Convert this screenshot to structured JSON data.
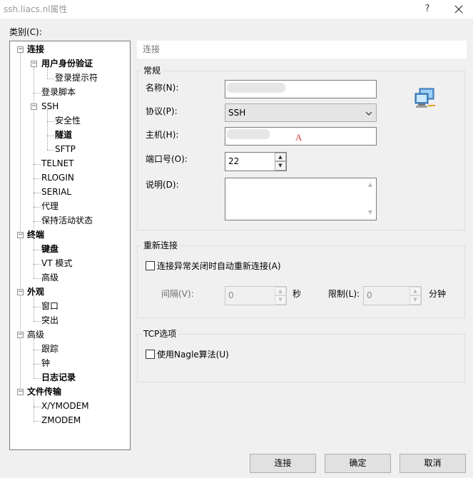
{
  "window": {
    "title": "ssh.liacs.nl属性",
    "help": "?",
    "close_icon": "close-icon"
  },
  "category_label": "类别(C):",
  "tree": {
    "items": [
      {
        "label": "连接",
        "bold": true,
        "expander": "−"
      },
      {
        "label": "用户身份验证",
        "bold": true,
        "expander": "−"
      },
      {
        "label": "登录提示符",
        "bold": false
      },
      {
        "label": "登录脚本",
        "bold": false
      },
      {
        "label": "SSH",
        "bold": false,
        "expander": "−"
      },
      {
        "label": "安全性",
        "bold": false
      },
      {
        "label": "隧道",
        "bold": true
      },
      {
        "label": "SFTP",
        "bold": false
      },
      {
        "label": "TELNET",
        "bold": false
      },
      {
        "label": "RLOGIN",
        "bold": false
      },
      {
        "label": "SERIAL",
        "bold": false
      },
      {
        "label": "代理",
        "bold": false
      },
      {
        "label": "保持活动状态",
        "bold": false
      },
      {
        "label": "终端",
        "bold": true,
        "expander": "−"
      },
      {
        "label": "键盘",
        "bold": true
      },
      {
        "label": "VT 模式",
        "bold": false
      },
      {
        "label": "高级",
        "bold": false
      },
      {
        "label": "外观",
        "bold": true,
        "expander": "−"
      },
      {
        "label": "窗口",
        "bold": false
      },
      {
        "label": "突出",
        "bold": false
      },
      {
        "label": "高级",
        "bold": false,
        "expander": "−"
      },
      {
        "label": "跟踪",
        "bold": false
      },
      {
        "label": "钟",
        "bold": false
      },
      {
        "label": "日志记录",
        "bold": true
      },
      {
        "label": "文件传输",
        "bold": true,
        "expander": "−"
      },
      {
        "label": "X/YMODEM",
        "bold": false
      },
      {
        "label": "ZMODEM",
        "bold": false
      }
    ]
  },
  "section_header": "连接",
  "general": {
    "title": "常规",
    "name_label": "名称(N):",
    "name_value": "",
    "protocol_label": "协议(P):",
    "protocol_value": "SSH",
    "host_label": "主机(H):",
    "host_value": "",
    "host_cursor": "A",
    "port_label": "端口号(O):",
    "port_value": "22",
    "desc_label": "说明(D):",
    "desc_value": "",
    "computer_icon": "network-computer-icon"
  },
  "reconnect": {
    "title": "重新连接",
    "checkbox_label": "连接异常关闭时自动重新连接(A)",
    "checked": false,
    "interval_label": "间隔(V):",
    "interval_value": "0",
    "seconds_unit": "秒",
    "limit_label": "限制(L):",
    "limit_value": "0",
    "minutes_unit": "分钟"
  },
  "tcp": {
    "title": "TCP选项",
    "nagle_label": "使用Nagle算法(U)",
    "checked": false
  },
  "buttons": {
    "connect": "连接",
    "ok": "确定",
    "cancel": "取消"
  }
}
